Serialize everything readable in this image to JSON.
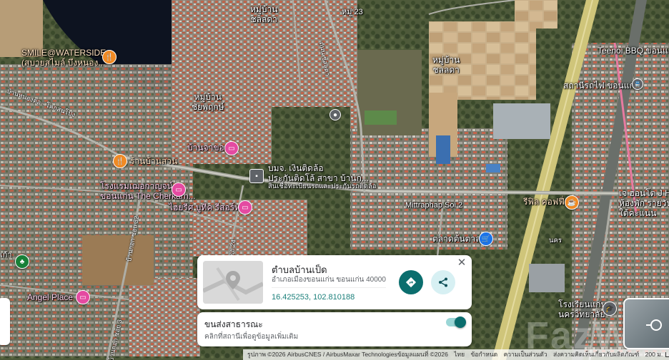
{
  "map": {
    "labels": {
      "village_chonlada_top": "หมู่บ้าน\nชลลดา",
      "moo_23": "หมู่ 23",
      "village_chonlada_right": "หมู่บ้าน\nชลลดา",
      "teenoi": "Teenoi BBQ ขอนแก่",
      "village_chaiyaphruek": "หมู่บ้าน\nชัยพฤกษ์",
      "smile_waterside": "SMILE@WATERSIDE\n(สบายสไมล์ บึงหนอง...",
      "ban_suan": "ร้านบ้านสวน",
      "banjachong": "บ้านจาของ",
      "cherkarn": "โรงแรมเฌอกาญจน์\nขอนแก่น The Cherkarn...",
      "ngoen_tid_lor": "บมจ. เงินติดล้อ\nประกันติดโล้ สาขา บ้านก...",
      "ngoen_tid_lor_sub": "สินเชื่อทะเบียนรถและประกันรถติดล้อ",
      "boutique": "ไฮยรีศ บูทีค รีสอร์ท",
      "mittraphap": "Mittraphap Soi 2",
      "rifle_coffee": "รีฟิล คอฟฟี่",
      "talad": "ตลาดต้นตาล",
      "electric": "สถานีรถไฟ ขอนแก่น",
      "j_home": "เจ ฮอนโต J Ho\nห้องพัก รายวัน ร\nใต้คะแนน",
      "angel_place": "Angel Place",
      "school": "โรงเรียนแก่น\nนครวิทยาลัย",
      "ban_nong_road": "บ้านหนองต่อ - โคกสนโปง",
      "soi_32": "บ้านกอก ซอย 32",
      "soi_24": "ซอย 24",
      "soi_3": "บ้านกอก ซอย 3",
      "side_road": "ถนน ชลลดา",
      "nakon": "นคร",
      "left_edge": "เก้า"
    }
  },
  "info_card": {
    "title": "ตำบลบ้านเป็ด",
    "address": "อำเภอเมืองขอนแก่น ขอนแก่น 40000",
    "coords": "16.425253, 102.810188",
    "close_icon": "close-icon",
    "directions_icon": "directions-icon",
    "share_icon": "share-icon"
  },
  "transit_card": {
    "title": "ขนส่งสาธารณะ",
    "subtitle": "คลิกที่สถานีเพื่อดูข้อมูลเพิ่มเติม",
    "toggle_on": true
  },
  "footer": {
    "imagery": "รูปภาพ ©2026 AirbusCNES / AirbusMaxar Technologiesข้อมูลแผนที่ ©2026",
    "thai": "ไทย",
    "terms": "ข้อกำหนด",
    "privacy": "ความเป็นส่วนตัว",
    "feedback": "ส่งความคิดเห็นเกี่ยวกับผลิตภัณฑ์",
    "scale": "200 ม."
  },
  "watermark": "FazWaz",
  "colors": {
    "accent": "#0b6e6e",
    "coords": "#1a7f7a",
    "pin_orange": "#f08a24",
    "pin_pink": "#e44aa1",
    "pin_blue": "#1a73e8",
    "pin_green": "#188038"
  }
}
